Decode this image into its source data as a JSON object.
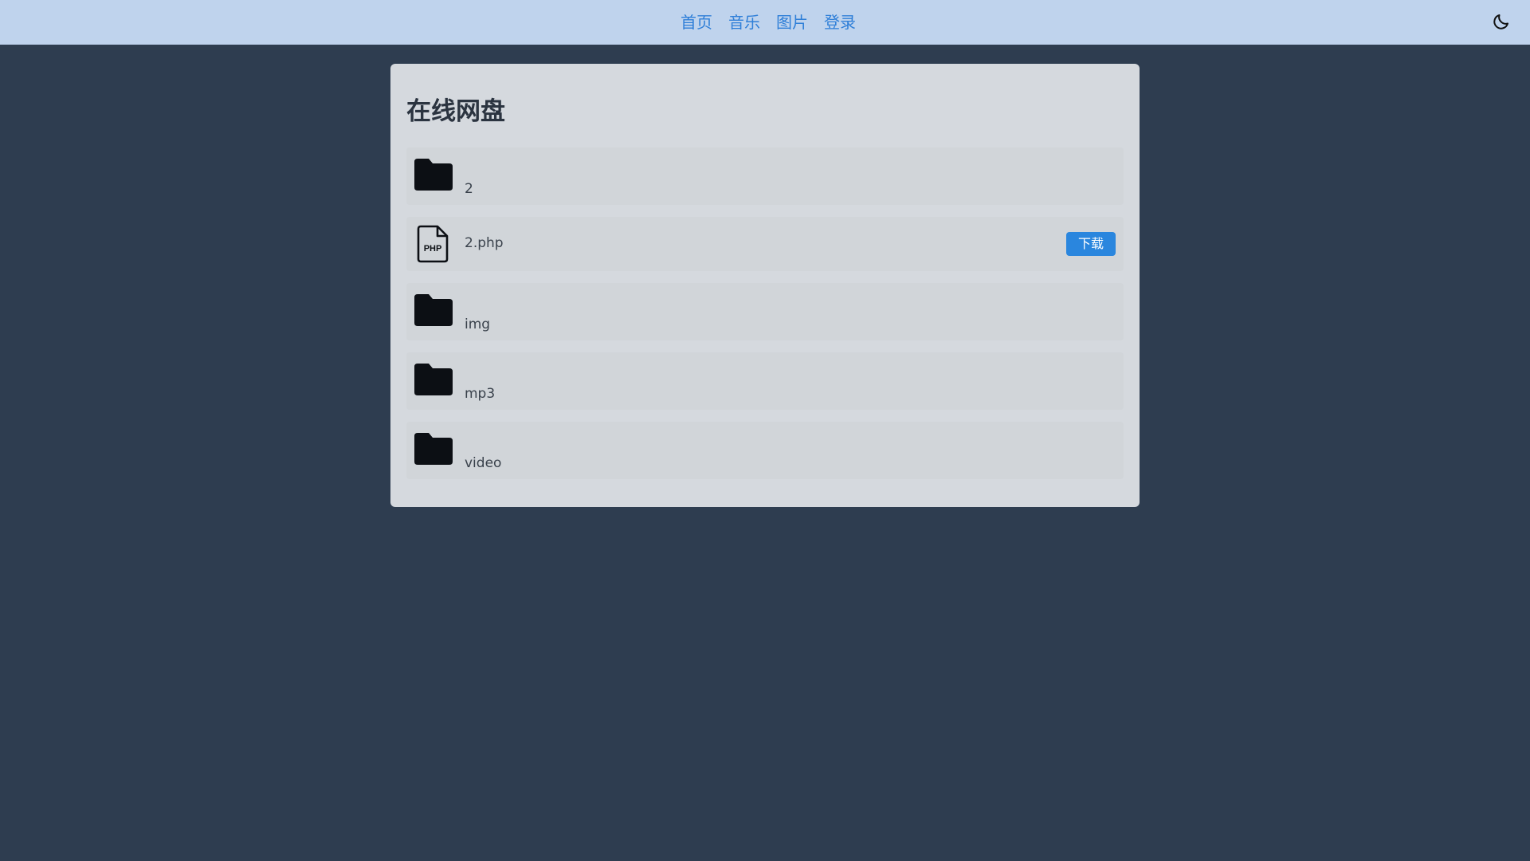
{
  "nav": {
    "items": [
      {
        "label": "首页"
      },
      {
        "label": "音乐"
      },
      {
        "label": "图片"
      },
      {
        "label": "登录"
      }
    ],
    "link_color": "#2f7fd8",
    "theme_toggle_icon": "moon-icon"
  },
  "main": {
    "title": "在线网盘",
    "files": [
      {
        "name": "2",
        "type": "folder",
        "icon": "folder-icon"
      },
      {
        "name": "2.php",
        "type": "file",
        "icon": "php-file-icon",
        "icon_label": "PHP",
        "action_label": "下载"
      },
      {
        "name": "img",
        "type": "folder",
        "icon": "folder-icon"
      },
      {
        "name": "mp3",
        "type": "folder",
        "icon": "folder-icon"
      },
      {
        "name": "video",
        "type": "folder",
        "icon": "folder-icon"
      }
    ]
  },
  "colors": {
    "page_background": "#2e3d50",
    "topbar_background": "#bfd3ed",
    "panel_background": "#d5d9de",
    "row_background": "#d1d5d9",
    "button_background": "#2a86de"
  }
}
